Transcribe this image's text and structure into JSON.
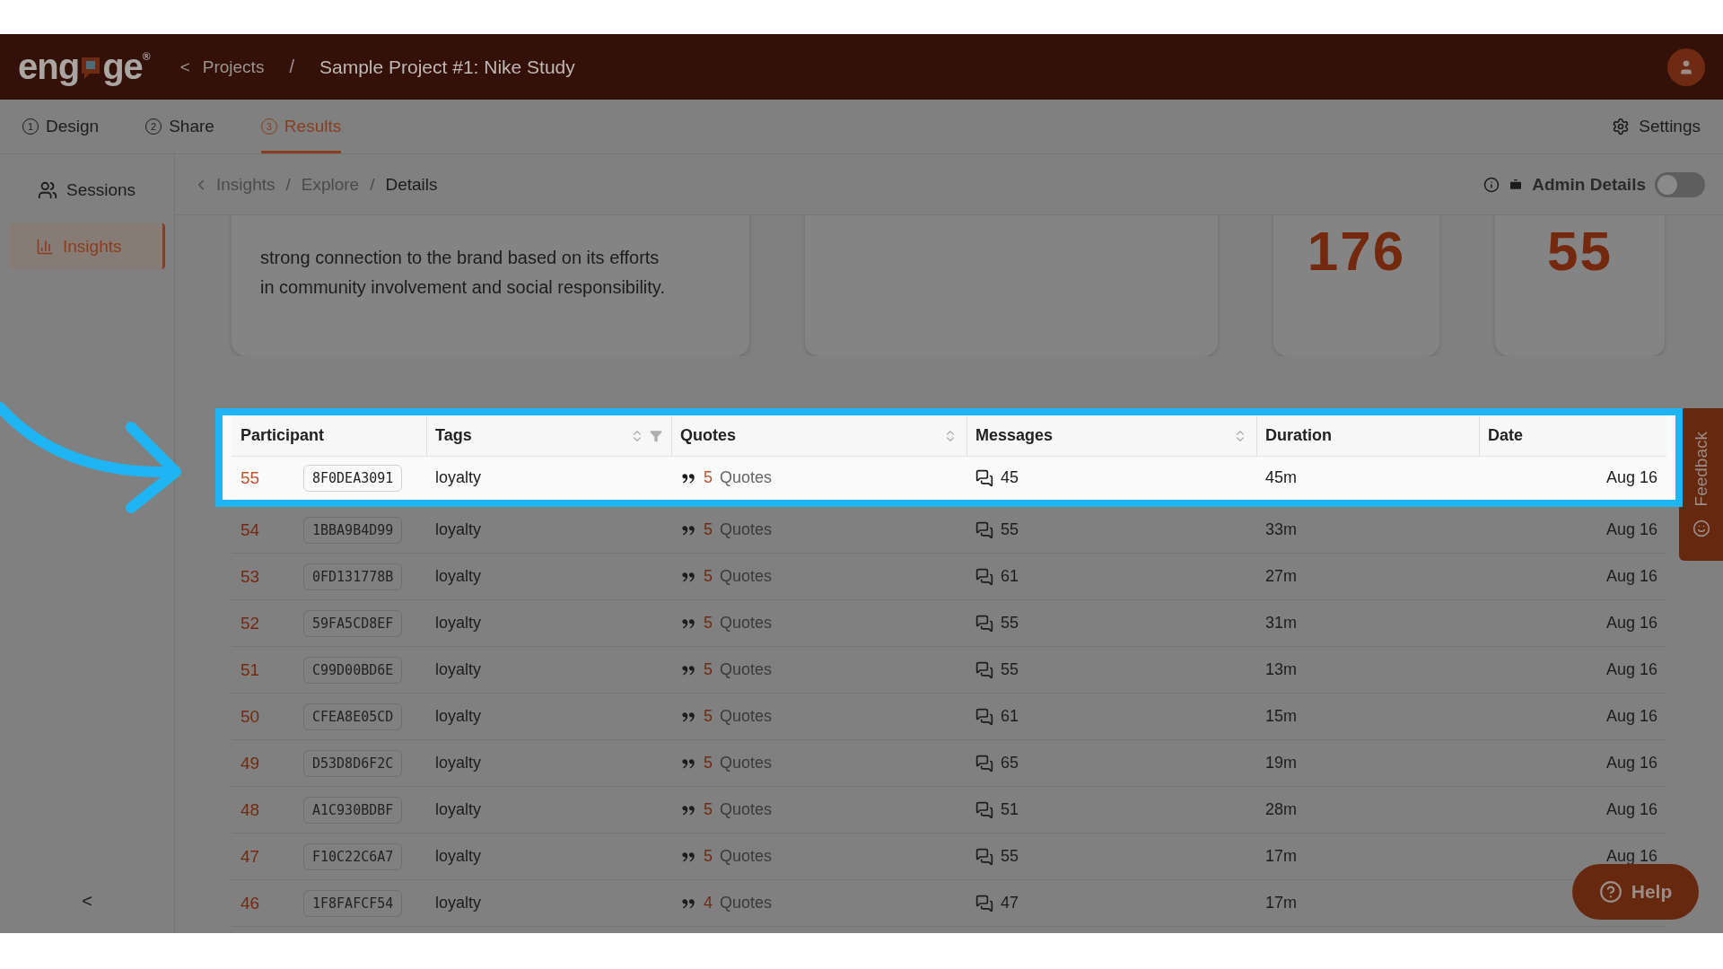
{
  "header": {
    "logo": {
      "before": "eng",
      "after": "ge",
      "mark": "®"
    },
    "back": "<",
    "crumbs": [
      {
        "label": "Projects"
      },
      {
        "label": "Sample Project #1: Nike Study"
      }
    ],
    "separator": "/"
  },
  "tabs": [
    {
      "number": "1",
      "label": "Design",
      "selected": false
    },
    {
      "number": "2",
      "label": "Share",
      "selected": false
    },
    {
      "number": "3",
      "label": "Results",
      "selected": true
    }
  ],
  "settings": {
    "label": "Settings"
  },
  "sidebar": {
    "items": [
      {
        "kind": "people",
        "label": "Sessions",
        "selected": false
      },
      {
        "kind": "chart",
        "label": "Insights",
        "selected": true
      }
    ],
    "collapse": "<"
  },
  "breadcrumb": {
    "items": [
      {
        "label": "Insights",
        "current": false
      },
      {
        "label": "Explore",
        "current": false
      },
      {
        "label": "Details",
        "current": true
      }
    ],
    "separator": "/"
  },
  "admin_details": {
    "label": "Admin Details",
    "on": false
  },
  "cards": [
    {
      "kind": "text",
      "lines": [
        "strong connection to the brand based on its efforts",
        "in community involvement and social responsibility."
      ]
    },
    {
      "kind": "blank"
    },
    {
      "kind": "stat",
      "value": "176"
    },
    {
      "kind": "stat",
      "value": "55"
    }
  ],
  "table": {
    "header_highlighted": true,
    "columns": [
      {
        "label": "Participant",
        "sortable": false,
        "filter": false
      },
      {
        "label": "Tags",
        "sortable": true,
        "filter": true
      },
      {
        "label": "Quotes",
        "sortable": true,
        "filter": false
      },
      {
        "label": "Messages",
        "sortable": true,
        "filter": false
      },
      {
        "label": "Duration",
        "sortable": false,
        "filter": false
      },
      {
        "label": "Date",
        "sortable": false,
        "filter": false
      }
    ],
    "rows": [
      {
        "number": "55",
        "id": "8F0DEA3091",
        "tag": "loyalty",
        "quotes": "5",
        "quotes_label": "Quotes",
        "messages": "45",
        "duration": "45m",
        "date": "Aug 16",
        "highlighted": true
      },
      {
        "number": "54",
        "id": "1BBA9B4D99",
        "tag": "loyalty",
        "quotes": "5",
        "quotes_label": "Quotes",
        "messages": "55",
        "duration": "33m",
        "date": "Aug 16",
        "highlighted": false
      },
      {
        "number": "53",
        "id": "0FD131778B",
        "tag": "loyalty",
        "quotes": "5",
        "quotes_label": "Quotes",
        "messages": "61",
        "duration": "27m",
        "date": "Aug 16",
        "highlighted": false
      },
      {
        "number": "52",
        "id": "59FA5CD8EF",
        "tag": "loyalty",
        "quotes": "5",
        "quotes_label": "Quotes",
        "messages": "55",
        "duration": "31m",
        "date": "Aug 16",
        "highlighted": false
      },
      {
        "number": "51",
        "id": "C99D00BD6E",
        "tag": "loyalty",
        "quotes": "5",
        "quotes_label": "Quotes",
        "messages": "55",
        "duration": "13m",
        "date": "Aug 16",
        "highlighted": false
      },
      {
        "number": "50",
        "id": "CFEA8E05CD",
        "tag": "loyalty",
        "quotes": "5",
        "quotes_label": "Quotes",
        "messages": "61",
        "duration": "15m",
        "date": "Aug 16",
        "highlighted": false
      },
      {
        "number": "49",
        "id": "D53D8D6F2C",
        "tag": "loyalty",
        "quotes": "5",
        "quotes_label": "Quotes",
        "messages": "65",
        "duration": "19m",
        "date": "Aug 16",
        "highlighted": false
      },
      {
        "number": "48",
        "id": "A1C930BDBF",
        "tag": "loyalty",
        "quotes": "5",
        "quotes_label": "Quotes",
        "messages": "51",
        "duration": "28m",
        "date": "Aug 16",
        "highlighted": false
      },
      {
        "number": "47",
        "id": "F10C22C6A7",
        "tag": "loyalty",
        "quotes": "5",
        "quotes_label": "Quotes",
        "messages": "55",
        "duration": "17m",
        "date": "Aug 16",
        "highlighted": false
      },
      {
        "number": "46",
        "id": "1F8FAFCF54",
        "tag": "loyalty",
        "quotes": "4",
        "quotes_label": "Quotes",
        "messages": "47",
        "duration": "17m",
        "date": "",
        "highlighted": false
      }
    ]
  },
  "feedback": {
    "label": "Feedback"
  },
  "help": {
    "label": "Help"
  }
}
